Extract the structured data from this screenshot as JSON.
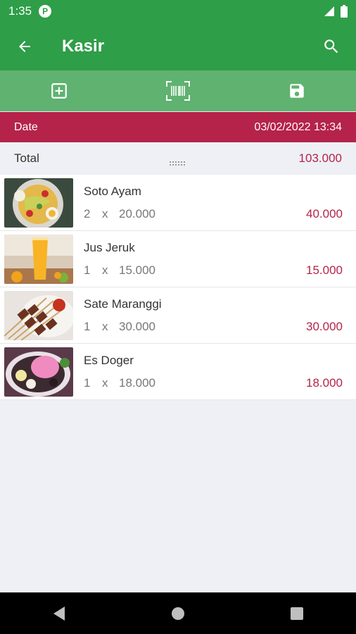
{
  "status_bar": {
    "time": "1:35",
    "app_badge": "P"
  },
  "app_bar": {
    "title": "Kasir",
    "back_icon": "arrow-left-icon",
    "search_icon": "search-icon"
  },
  "toolbar": {
    "add_icon": "add-box-icon",
    "scan_icon": "barcode-scan-icon",
    "save_icon": "save-icon"
  },
  "date": {
    "label": "Date",
    "value": "03/02/2022 13:34"
  },
  "total": {
    "label": "Total",
    "value": "103.000"
  },
  "items": [
    {
      "name": "Soto Ayam",
      "qty": "2",
      "x": "x",
      "price": "20.000",
      "subtotal": "40.000"
    },
    {
      "name": "Jus Jeruk",
      "qty": "1",
      "x": "x",
      "price": "15.000",
      "subtotal": "15.000"
    },
    {
      "name": "Sate Maranggi",
      "qty": "1",
      "x": "x",
      "price": "30.000",
      "subtotal": "30.000"
    },
    {
      "name": "Es Doger",
      "qty": "1",
      "x": "x",
      "price": "18.000",
      "subtotal": "18.000"
    }
  ],
  "colors": {
    "primary": "#2e9e48",
    "toolbar": "#5fb26f",
    "accent": "#b5234a",
    "background": "#eef0f5"
  }
}
